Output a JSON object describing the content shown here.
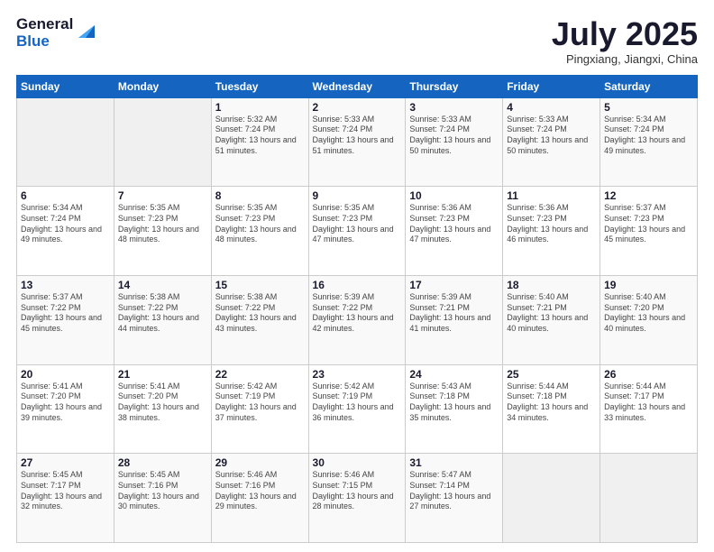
{
  "logo": {
    "general": "General",
    "blue": "Blue"
  },
  "header": {
    "title": "July 2025",
    "subtitle": "Pingxiang, Jiangxi, China"
  },
  "weekdays": [
    "Sunday",
    "Monday",
    "Tuesday",
    "Wednesday",
    "Thursday",
    "Friday",
    "Saturday"
  ],
  "weeks": [
    [
      {
        "day": "",
        "empty": true
      },
      {
        "day": "",
        "empty": true
      },
      {
        "day": "1",
        "sunrise": "Sunrise: 5:32 AM",
        "sunset": "Sunset: 7:24 PM",
        "daylight": "Daylight: 13 hours and 51 minutes."
      },
      {
        "day": "2",
        "sunrise": "Sunrise: 5:33 AM",
        "sunset": "Sunset: 7:24 PM",
        "daylight": "Daylight: 13 hours and 51 minutes."
      },
      {
        "day": "3",
        "sunrise": "Sunrise: 5:33 AM",
        "sunset": "Sunset: 7:24 PM",
        "daylight": "Daylight: 13 hours and 50 minutes."
      },
      {
        "day": "4",
        "sunrise": "Sunrise: 5:33 AM",
        "sunset": "Sunset: 7:24 PM",
        "daylight": "Daylight: 13 hours and 50 minutes."
      },
      {
        "day": "5",
        "sunrise": "Sunrise: 5:34 AM",
        "sunset": "Sunset: 7:24 PM",
        "daylight": "Daylight: 13 hours and 49 minutes."
      }
    ],
    [
      {
        "day": "6",
        "sunrise": "Sunrise: 5:34 AM",
        "sunset": "Sunset: 7:24 PM",
        "daylight": "Daylight: 13 hours and 49 minutes."
      },
      {
        "day": "7",
        "sunrise": "Sunrise: 5:35 AM",
        "sunset": "Sunset: 7:23 PM",
        "daylight": "Daylight: 13 hours and 48 minutes."
      },
      {
        "day": "8",
        "sunrise": "Sunrise: 5:35 AM",
        "sunset": "Sunset: 7:23 PM",
        "daylight": "Daylight: 13 hours and 48 minutes."
      },
      {
        "day": "9",
        "sunrise": "Sunrise: 5:35 AM",
        "sunset": "Sunset: 7:23 PM",
        "daylight": "Daylight: 13 hours and 47 minutes."
      },
      {
        "day": "10",
        "sunrise": "Sunrise: 5:36 AM",
        "sunset": "Sunset: 7:23 PM",
        "daylight": "Daylight: 13 hours and 47 minutes."
      },
      {
        "day": "11",
        "sunrise": "Sunrise: 5:36 AM",
        "sunset": "Sunset: 7:23 PM",
        "daylight": "Daylight: 13 hours and 46 minutes."
      },
      {
        "day": "12",
        "sunrise": "Sunrise: 5:37 AM",
        "sunset": "Sunset: 7:23 PM",
        "daylight": "Daylight: 13 hours and 45 minutes."
      }
    ],
    [
      {
        "day": "13",
        "sunrise": "Sunrise: 5:37 AM",
        "sunset": "Sunset: 7:22 PM",
        "daylight": "Daylight: 13 hours and 45 minutes."
      },
      {
        "day": "14",
        "sunrise": "Sunrise: 5:38 AM",
        "sunset": "Sunset: 7:22 PM",
        "daylight": "Daylight: 13 hours and 44 minutes."
      },
      {
        "day": "15",
        "sunrise": "Sunrise: 5:38 AM",
        "sunset": "Sunset: 7:22 PM",
        "daylight": "Daylight: 13 hours and 43 minutes."
      },
      {
        "day": "16",
        "sunrise": "Sunrise: 5:39 AM",
        "sunset": "Sunset: 7:22 PM",
        "daylight": "Daylight: 13 hours and 42 minutes."
      },
      {
        "day": "17",
        "sunrise": "Sunrise: 5:39 AM",
        "sunset": "Sunset: 7:21 PM",
        "daylight": "Daylight: 13 hours and 41 minutes."
      },
      {
        "day": "18",
        "sunrise": "Sunrise: 5:40 AM",
        "sunset": "Sunset: 7:21 PM",
        "daylight": "Daylight: 13 hours and 40 minutes."
      },
      {
        "day": "19",
        "sunrise": "Sunrise: 5:40 AM",
        "sunset": "Sunset: 7:20 PM",
        "daylight": "Daylight: 13 hours and 40 minutes."
      }
    ],
    [
      {
        "day": "20",
        "sunrise": "Sunrise: 5:41 AM",
        "sunset": "Sunset: 7:20 PM",
        "daylight": "Daylight: 13 hours and 39 minutes."
      },
      {
        "day": "21",
        "sunrise": "Sunrise: 5:41 AM",
        "sunset": "Sunset: 7:20 PM",
        "daylight": "Daylight: 13 hours and 38 minutes."
      },
      {
        "day": "22",
        "sunrise": "Sunrise: 5:42 AM",
        "sunset": "Sunset: 7:19 PM",
        "daylight": "Daylight: 13 hours and 37 minutes."
      },
      {
        "day": "23",
        "sunrise": "Sunrise: 5:42 AM",
        "sunset": "Sunset: 7:19 PM",
        "daylight": "Daylight: 13 hours and 36 minutes."
      },
      {
        "day": "24",
        "sunrise": "Sunrise: 5:43 AM",
        "sunset": "Sunset: 7:18 PM",
        "daylight": "Daylight: 13 hours and 35 minutes."
      },
      {
        "day": "25",
        "sunrise": "Sunrise: 5:44 AM",
        "sunset": "Sunset: 7:18 PM",
        "daylight": "Daylight: 13 hours and 34 minutes."
      },
      {
        "day": "26",
        "sunrise": "Sunrise: 5:44 AM",
        "sunset": "Sunset: 7:17 PM",
        "daylight": "Daylight: 13 hours and 33 minutes."
      }
    ],
    [
      {
        "day": "27",
        "sunrise": "Sunrise: 5:45 AM",
        "sunset": "Sunset: 7:17 PM",
        "daylight": "Daylight: 13 hours and 32 minutes."
      },
      {
        "day": "28",
        "sunrise": "Sunrise: 5:45 AM",
        "sunset": "Sunset: 7:16 PM",
        "daylight": "Daylight: 13 hours and 30 minutes."
      },
      {
        "day": "29",
        "sunrise": "Sunrise: 5:46 AM",
        "sunset": "Sunset: 7:16 PM",
        "daylight": "Daylight: 13 hours and 29 minutes."
      },
      {
        "day": "30",
        "sunrise": "Sunrise: 5:46 AM",
        "sunset": "Sunset: 7:15 PM",
        "daylight": "Daylight: 13 hours and 28 minutes."
      },
      {
        "day": "31",
        "sunrise": "Sunrise: 5:47 AM",
        "sunset": "Sunset: 7:14 PM",
        "daylight": "Daylight: 13 hours and 27 minutes."
      },
      {
        "day": "",
        "empty": true
      },
      {
        "day": "",
        "empty": true
      }
    ]
  ]
}
